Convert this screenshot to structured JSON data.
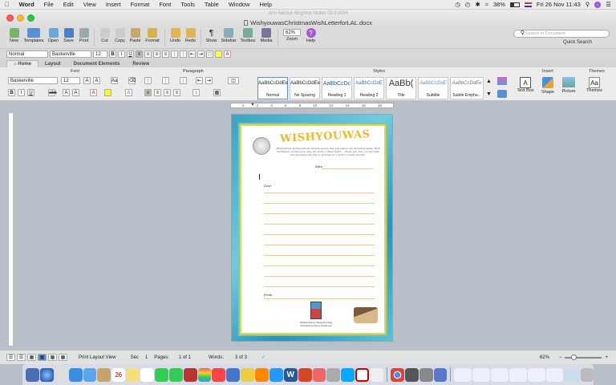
{
  "menubar": {
    "apple": "",
    "app": "Word",
    "items": [
      "File",
      "Edit",
      "View",
      "Insert",
      "Format",
      "Font",
      "Tools",
      "Table",
      "Window",
      "Help"
    ],
    "battery": "38%",
    "datetime": "Fri 26 Nov  11:43"
  },
  "window": {
    "faded_title": "Ann Nelson Brighton Notes OL9 ADH",
    "doc_title": "WishyouwasChristmasWishLetterforLAL.docx"
  },
  "toolbar": {
    "buttons": [
      "New",
      "Templates",
      "Open",
      "Save",
      "Print",
      "Cut",
      "Copy",
      "Paste",
      "Format",
      "Undo",
      "Redo",
      "Show",
      "Sidebar",
      "Toolbox",
      "Media",
      "Zoom",
      "Help"
    ],
    "zoom": "62%",
    "search_placeholder": "Search in Document",
    "quick_search": "Quick Search"
  },
  "format_bar": {
    "style": "Normal",
    "font": "Baskerville",
    "size": "12"
  },
  "tabs": [
    "Home",
    "Layout",
    "Document Elements",
    "Review"
  ],
  "ribbon": {
    "groups": [
      "Font",
      "Paragraph",
      "Styles",
      "Insert",
      "Themes"
    ],
    "font": "Baskerville",
    "size": "12",
    "styles": [
      {
        "sample": "AaBbCcDdEe",
        "name": "Normal"
      },
      {
        "sample": "AaBbCcDdEe",
        "name": "No Spacing"
      },
      {
        "sample": "AaBbCcDc",
        "name": "Heading 1"
      },
      {
        "sample": "AaBbCcDdE",
        "name": "Heading 2"
      },
      {
        "sample": "AaBb(",
        "name": "Title"
      },
      {
        "sample": "AaBbCcDdE",
        "name": "Subtitle"
      },
      {
        "sample": "AaBbCcDdEe",
        "name": "Subtle Empha..."
      }
    ],
    "insert": [
      "Text Box",
      "Shape",
      "Picture"
    ],
    "themes": [
      "Themes"
    ]
  },
  "ruler_marks": [
    "2",
    "2",
    "4",
    "6",
    "8",
    "10",
    "12",
    "14",
    "16",
    "18"
  ],
  "letter": {
    "brand": "WISHYOUWAS",
    "intro": "Wishyouwas, Penny and her friends secure that lost letters are delivered safely. With Christmas coming soon, why not write a letter? Dear... Thank you. You can decorate the envelope and give to perhaps to a writer a lovely special!",
    "date_label": "Date",
    "dear_label": "Dear",
    "from_label": "From",
    "credit1": "Wishyouwas by Alexandra Page",
    "credit2": "Illustrated by Penny Neville-Lee"
  },
  "status": {
    "view": "Print Layout View",
    "sec_label": "Sec",
    "sec": "1",
    "pages_label": "Pages:",
    "pages": "1 of 1",
    "words_label": "Words:",
    "words": "3 of 3",
    "zoom": "62%"
  },
  "colors": {
    "page_bg": "#3aa4c4",
    "frame_border": "#f1d341",
    "lines": "#f0c987"
  }
}
